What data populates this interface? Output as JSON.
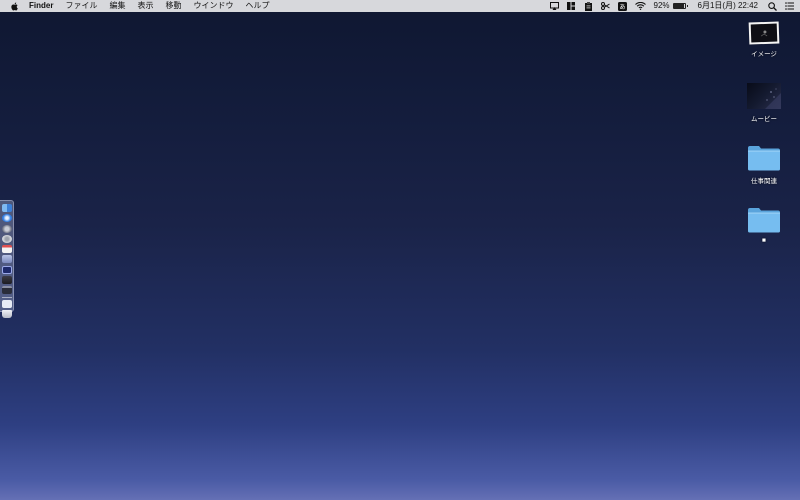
{
  "menubar": {
    "app_name": "Finder",
    "menus": [
      "ファイル",
      "編集",
      "表示",
      "移動",
      "ウインドウ",
      "ヘルプ"
    ],
    "status_icons": [
      "airplay-icon",
      "window-layout-icon",
      "clipboard-icon",
      "scissors-icon",
      "input-source-icon",
      "wifi-icon"
    ],
    "battery": "92%",
    "battery_level": 0.92,
    "clock": "6月1日(月)  22:42"
  },
  "desktop_icons": [
    {
      "name": "image-file-icon",
      "label": "イメージ"
    },
    {
      "name": "movie-file-icon",
      "label": "ムービー"
    },
    {
      "name": "folder-icon",
      "label": "仕事関連"
    },
    {
      "name": "folder-icon",
      "label": "■"
    }
  ],
  "dock": {
    "items": [
      "finder-icon",
      "safari-icon",
      "rocket-icon",
      "settings-icon",
      "calendar-icon",
      "photos-icon",
      "terminal-icon",
      "display-icon",
      "keyboard-icon",
      "preview-icon",
      "trash-icon"
    ]
  },
  "colors": {
    "menubar_bg": "#d7d8dc",
    "folder_blue": "#6fb6e8",
    "desktop_top": "#0f1731",
    "desktop_bottom": "#6570b5"
  }
}
